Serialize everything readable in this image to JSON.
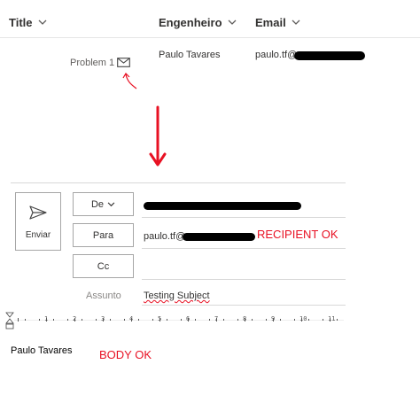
{
  "list": {
    "columns": [
      "Title",
      "Engenheiro",
      "Email"
    ],
    "row": {
      "title": "Problem 1",
      "engenheiro": "Paulo Tavares",
      "email_prefix": "paulo.tf@"
    }
  },
  "compose": {
    "send_label": "Enviar",
    "from_label": "De",
    "to_label": "Para",
    "cc_label": "Cc",
    "to_value_prefix": "paulo.tf@",
    "subject_label": "Assunto",
    "subject_value": "Testing Subject",
    "ruler_numbers": [
      "1",
      "2",
      "3",
      "4",
      "5",
      "6",
      "7",
      "8",
      "9",
      "10",
      "11"
    ],
    "body_text": "Paulo Tavares"
  },
  "annotations": {
    "recipient_ok": "RECIPIENT OK",
    "body_ok": "BODY OK",
    "arrow_color": "#e81123"
  },
  "icons": [
    "chevron-down-icon",
    "mail-icon",
    "send-icon",
    "down-arrow-annotation"
  ]
}
